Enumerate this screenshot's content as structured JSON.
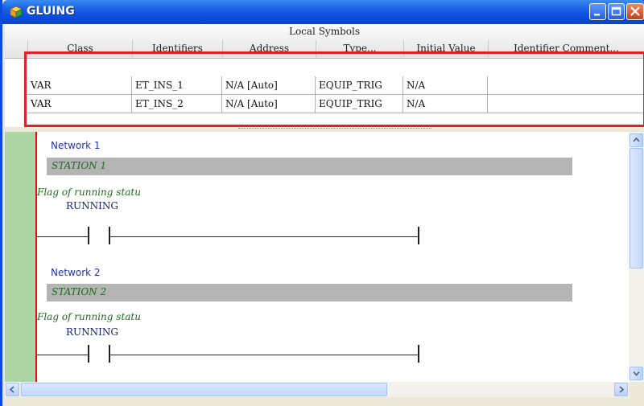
{
  "window": {
    "title": "GLUING",
    "icon": "gluing-app-icon",
    "controls": [
      "minimize-icon",
      "maximize-icon",
      "close-icon"
    ]
  },
  "symbols": {
    "group_title": "Local Symbols",
    "columns": [
      "Class",
      "Identifiers",
      "Address",
      "Type...",
      "Initial Value",
      "Identifier Comment..."
    ],
    "rows": [
      [
        "VAR",
        "ET_INS_1",
        "N/A [Auto]",
        "EQUIP_TRIG",
        "N/A",
        ""
      ],
      [
        "VAR",
        "ET_INS_2",
        "N/A [Auto]",
        "EQUIP_TRIG",
        "N/A",
        ""
      ]
    ],
    "highlight_color": "#e0202a"
  },
  "ladder": {
    "networks": [
      {
        "label": "Network 1",
        "station": "STATION 1",
        "comment": "Flag of running statu",
        "contact": "RUNNING"
      },
      {
        "label": "Network 2",
        "station": "STATION 2",
        "comment": "Flag of running statu",
        "contact": "RUNNING"
      }
    ],
    "rail_color": "#dd0e16",
    "comment_color": "#1f6b1f"
  }
}
